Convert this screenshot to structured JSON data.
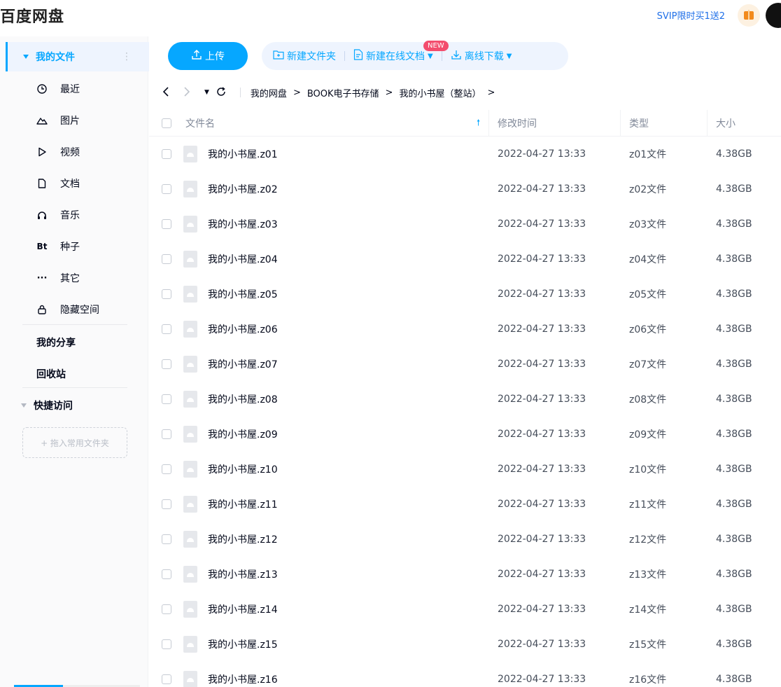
{
  "header": {
    "logo": "百度网盘",
    "promo": "SVIP限时买1送2",
    "gift_icon": "gift-icon"
  },
  "sidebar": {
    "my_files": "我的文件",
    "items": [
      {
        "label": "最近",
        "icon": "clock-icon"
      },
      {
        "label": "图片",
        "icon": "image-icon"
      },
      {
        "label": "视频",
        "icon": "video-icon"
      },
      {
        "label": "文档",
        "icon": "document-icon"
      },
      {
        "label": "音乐",
        "icon": "headphones-icon"
      },
      {
        "label": "种子",
        "icon": "bt-icon"
      },
      {
        "label": "其它",
        "icon": "more-icon"
      },
      {
        "label": "隐藏空间",
        "icon": "lock-icon"
      }
    ],
    "my_share": "我的分享",
    "recycle": "回收站",
    "quick_access": "快捷访问",
    "drop_hint": "+ 拖入常用文件夹"
  },
  "toolbar": {
    "upload": "上传",
    "new_folder": "新建文件夹",
    "new_doc": "新建在线文档",
    "new_badge": "NEW",
    "offline_download": "离线下载"
  },
  "breadcrumb": {
    "items": [
      "我的网盘",
      "BOOK电子书存储",
      "我的小书屋（整站）"
    ],
    "separator": ">"
  },
  "table": {
    "columns": {
      "name": "文件名",
      "modified": "修改时间",
      "type": "类型",
      "size": "大小"
    },
    "rows": [
      {
        "name": "我的小书屋.z01",
        "modified": "2022-04-27 13:33",
        "type": "z01文件",
        "size": "4.38GB"
      },
      {
        "name": "我的小书屋.z02",
        "modified": "2022-04-27 13:33",
        "type": "z02文件",
        "size": "4.38GB"
      },
      {
        "name": "我的小书屋.z03",
        "modified": "2022-04-27 13:33",
        "type": "z03文件",
        "size": "4.38GB"
      },
      {
        "name": "我的小书屋.z04",
        "modified": "2022-04-27 13:33",
        "type": "z04文件",
        "size": "4.38GB"
      },
      {
        "name": "我的小书屋.z05",
        "modified": "2022-04-27 13:33",
        "type": "z05文件",
        "size": "4.38GB"
      },
      {
        "name": "我的小书屋.z06",
        "modified": "2022-04-27 13:33",
        "type": "z06文件",
        "size": "4.38GB"
      },
      {
        "name": "我的小书屋.z07",
        "modified": "2022-04-27 13:33",
        "type": "z07文件",
        "size": "4.38GB"
      },
      {
        "name": "我的小书屋.z08",
        "modified": "2022-04-27 13:33",
        "type": "z08文件",
        "size": "4.38GB"
      },
      {
        "name": "我的小书屋.z09",
        "modified": "2022-04-27 13:33",
        "type": "z09文件",
        "size": "4.38GB"
      },
      {
        "name": "我的小书屋.z10",
        "modified": "2022-04-27 13:33",
        "type": "z10文件",
        "size": "4.38GB"
      },
      {
        "name": "我的小书屋.z11",
        "modified": "2022-04-27 13:33",
        "type": "z11文件",
        "size": "4.38GB"
      },
      {
        "name": "我的小书屋.z12",
        "modified": "2022-04-27 13:33",
        "type": "z12文件",
        "size": "4.38GB"
      },
      {
        "name": "我的小书屋.z13",
        "modified": "2022-04-27 13:33",
        "type": "z13文件",
        "size": "4.38GB"
      },
      {
        "name": "我的小书屋.z14",
        "modified": "2022-04-27 13:33",
        "type": "z14文件",
        "size": "4.38GB"
      },
      {
        "name": "我的小书屋.z15",
        "modified": "2022-04-27 13:33",
        "type": "z15文件",
        "size": "4.38GB"
      },
      {
        "name": "我的小书屋.z16",
        "modified": "2022-04-27 13:33",
        "type": "z16文件",
        "size": "4.38GB"
      }
    ]
  },
  "colors": {
    "accent": "#06a7ff",
    "promo": "#1f6fe8",
    "badge": "#f34d6d"
  }
}
